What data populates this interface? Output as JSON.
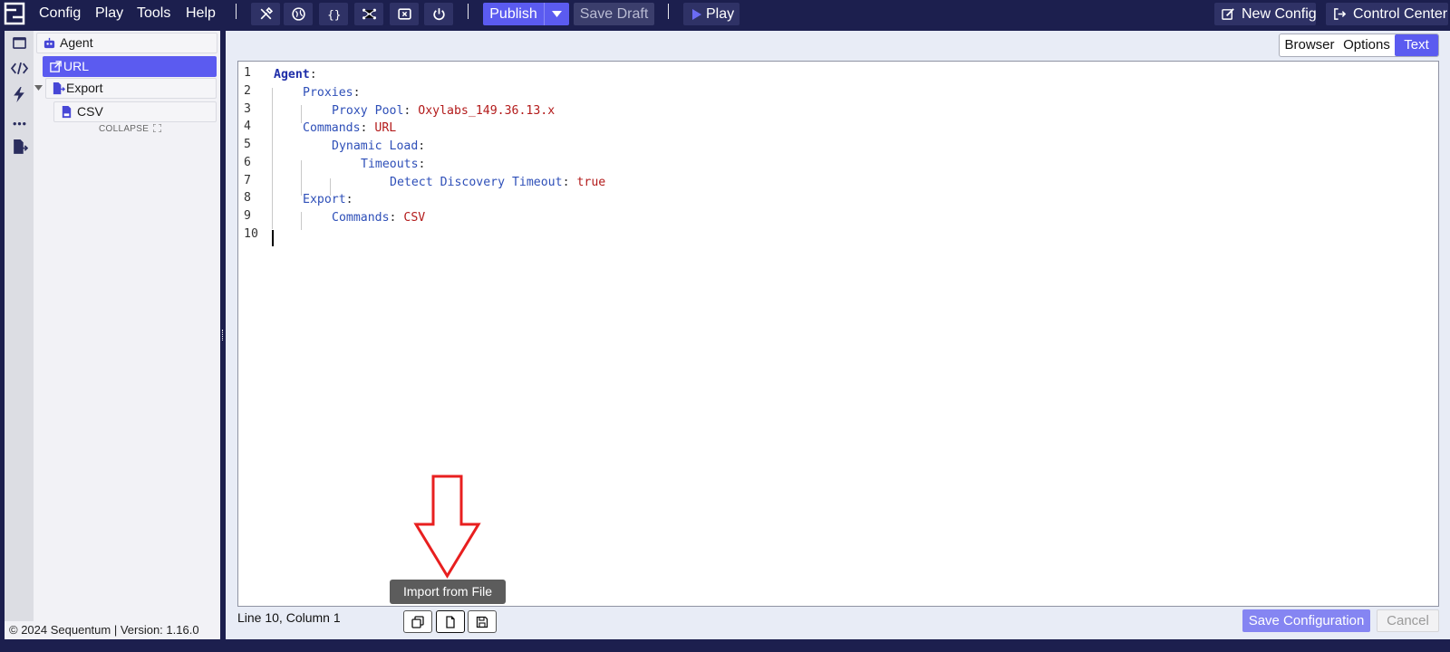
{
  "topbar": {
    "menus": [
      "Config",
      "Play",
      "Tools",
      "Help"
    ],
    "icons": [
      "wrench-screwdriver-icon",
      "globe-icon",
      "braces-icon",
      "network-icon",
      "close-box-icon",
      "power-icon"
    ],
    "publish_label": "Publish",
    "save_draft_label": "Save Draft",
    "play_label": "Play",
    "new_config_label": "New Config",
    "control_center_label": "Control Center"
  },
  "rail": {
    "icons": [
      "browser-window-icon",
      "code-icon",
      "lightning-icon",
      "more-icon",
      "export-file-icon"
    ]
  },
  "tree": {
    "nodes": [
      {
        "label": "Agent",
        "icon": "robot-icon"
      },
      {
        "label": "URL",
        "icon": "external-link-icon",
        "selected": true
      },
      {
        "label": "Export",
        "icon": "export-file-icon"
      },
      {
        "label": "CSV",
        "icon": "csv-file-icon"
      }
    ],
    "collapse_label": "COLLAPSE"
  },
  "footer": {
    "text": "© 2024 Sequentum | Version: 1.16.0"
  },
  "view_tabs": [
    "Browser",
    "Options",
    "Text"
  ],
  "active_view_tab": "Text",
  "editor": {
    "lines": [
      {
        "n": "1",
        "key": "Agent",
        "value": ""
      },
      {
        "n": "2",
        "key": "Proxies",
        "value": ""
      },
      {
        "n": "3",
        "key": "Proxy Pool",
        "value": "Oxylabs_149.36.13.x"
      },
      {
        "n": "4",
        "key": "Commands",
        "value": "URL"
      },
      {
        "n": "5",
        "key": "Dynamic Load",
        "value": ""
      },
      {
        "n": "6",
        "key": "Timeouts",
        "value": ""
      },
      {
        "n": "7",
        "key": "Detect Discovery Timeout",
        "value": "true"
      },
      {
        "n": "8",
        "key": "Export",
        "value": ""
      },
      {
        "n": "9",
        "key": "Commands",
        "value": "CSV"
      },
      {
        "n": "10",
        "key": "",
        "value": ""
      }
    ]
  },
  "status": {
    "position": "Line 10, Column 1"
  },
  "tooltip": "Import from File",
  "actions": {
    "save_configuration": "Save Configuration",
    "cancel": "Cancel"
  },
  "colors": {
    "brand_navy": "#1c1f4e",
    "accent": "#5b5bf0",
    "annotation_arrow": "#e81f1f"
  }
}
